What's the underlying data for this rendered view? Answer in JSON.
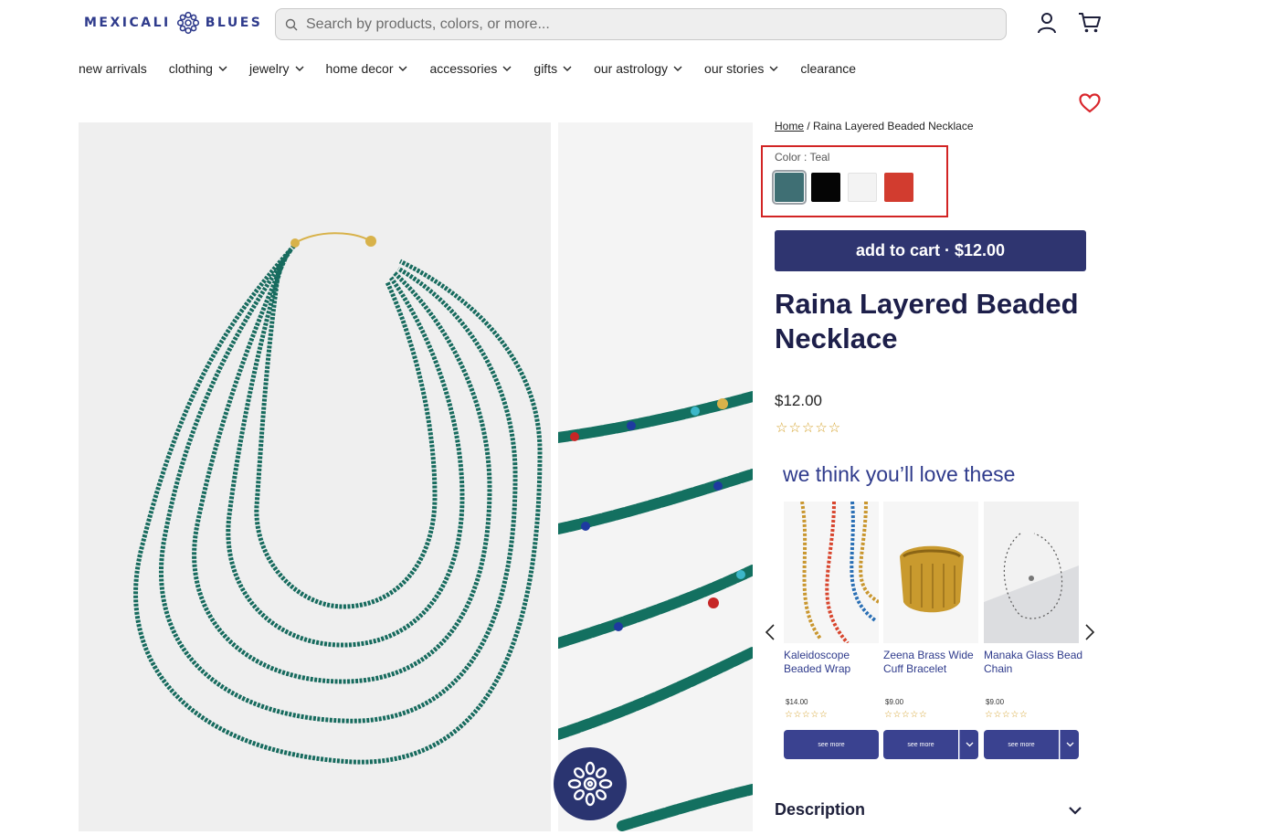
{
  "header": {
    "logo_left": "MEXICALI",
    "logo_right": "BLUES",
    "search_placeholder": "Search by products, colors, or more..."
  },
  "nav": [
    {
      "label": "new arrivals",
      "dropdown": false
    },
    {
      "label": "clothing",
      "dropdown": true
    },
    {
      "label": "jewelry",
      "dropdown": true
    },
    {
      "label": "home decor",
      "dropdown": true
    },
    {
      "label": "accessories",
      "dropdown": true
    },
    {
      "label": "gifts",
      "dropdown": true
    },
    {
      "label": "our astrology",
      "dropdown": true
    },
    {
      "label": "our stories",
      "dropdown": true
    },
    {
      "label": "clearance",
      "dropdown": false
    }
  ],
  "breadcrumb": {
    "home": "Home",
    "separator": "/",
    "current": "Raina Layered Beaded Necklace"
  },
  "color": {
    "label": "Color : Teal",
    "swatches": [
      {
        "name": "Teal",
        "hex": "#3f6f74",
        "selected": true
      },
      {
        "name": "Black",
        "hex": "#050505",
        "selected": false
      },
      {
        "name": "White",
        "hex": "#f3f3f3",
        "selected": false
      },
      {
        "name": "Red",
        "hex": "#d23c2f",
        "selected": false
      }
    ]
  },
  "product": {
    "add_to_cart": "add to cart · $12.00",
    "title": "Raina Layered Beaded Necklace",
    "price": "$12.00",
    "stars": "☆☆☆☆☆"
  },
  "recommendations": {
    "title": "we think you’ll love these",
    "items": [
      {
        "name": "Kaleidoscope Beaded Wrap",
        "price": "$14.00",
        "stars": "☆☆☆☆☆",
        "button": "see more",
        "has_dropdown": false
      },
      {
        "name": "Zeena Brass Wide Cuff Bracelet",
        "price": "$9.00",
        "stars": "☆☆☆☆☆",
        "button": "see more",
        "has_dropdown": true
      },
      {
        "name": "Manaka Glass Bead Chain",
        "price": "$9.00",
        "stars": "☆☆☆☆☆",
        "button": "see more",
        "has_dropdown": true
      }
    ]
  },
  "description": {
    "label": "Description"
  },
  "colors": {
    "brand": "#2f3b8c",
    "button": "#2f3570",
    "highlight": "#d22424",
    "star": "#d4a12a",
    "heart": "#d9262c"
  }
}
